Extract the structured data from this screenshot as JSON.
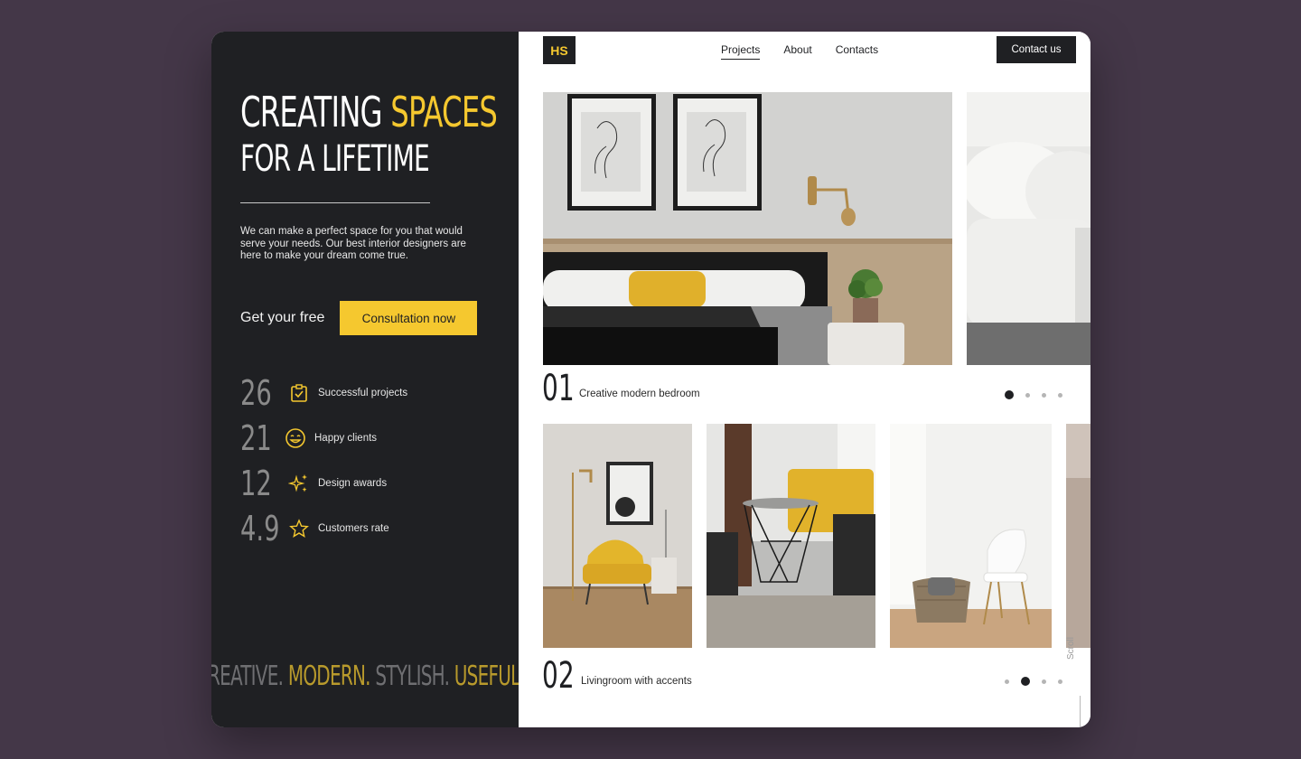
{
  "hero": {
    "line1_a": "CREATING",
    "line1_b": "SPACES",
    "line2": "FOR A LIFETIME",
    "description": "We can make a perfect space for you that would serve your needs. Our best interior designers are here to make your dream come true.",
    "cta_text": "Get your free",
    "cta_button": "Consultation now"
  },
  "stats": [
    {
      "value": "26",
      "label": "Successful projects",
      "icon": "clipboard-check-icon"
    },
    {
      "value": "21",
      "label": "Happy clients",
      "icon": "smile-icon"
    },
    {
      "value": "12",
      "label": "Design awards",
      "icon": "sparkles-icon"
    },
    {
      "value": "4.9",
      "label": "Customers rate",
      "icon": "star-icon"
    }
  ],
  "tagline": {
    "w1": "REATIVE.",
    "w2": "MODERN.",
    "w3": "STYLISH.",
    "w4": "USEFUL."
  },
  "nav": {
    "logo": "HS",
    "items": [
      "Projects",
      "About",
      "Contacts"
    ],
    "active": "Projects",
    "contact_button": "Contact us"
  },
  "projects": [
    {
      "number": "01",
      "title": "Creative modern bedroom",
      "active_dot": 1,
      "dot_count": 4
    },
    {
      "number": "02",
      "title": "Livingroom with accents",
      "active_dot": 2,
      "dot_count": 4
    }
  ],
  "scroll_label": "Scroll",
  "colors": {
    "accent": "#f5c82f",
    "dark": "#1f2023",
    "background": "#443748"
  }
}
